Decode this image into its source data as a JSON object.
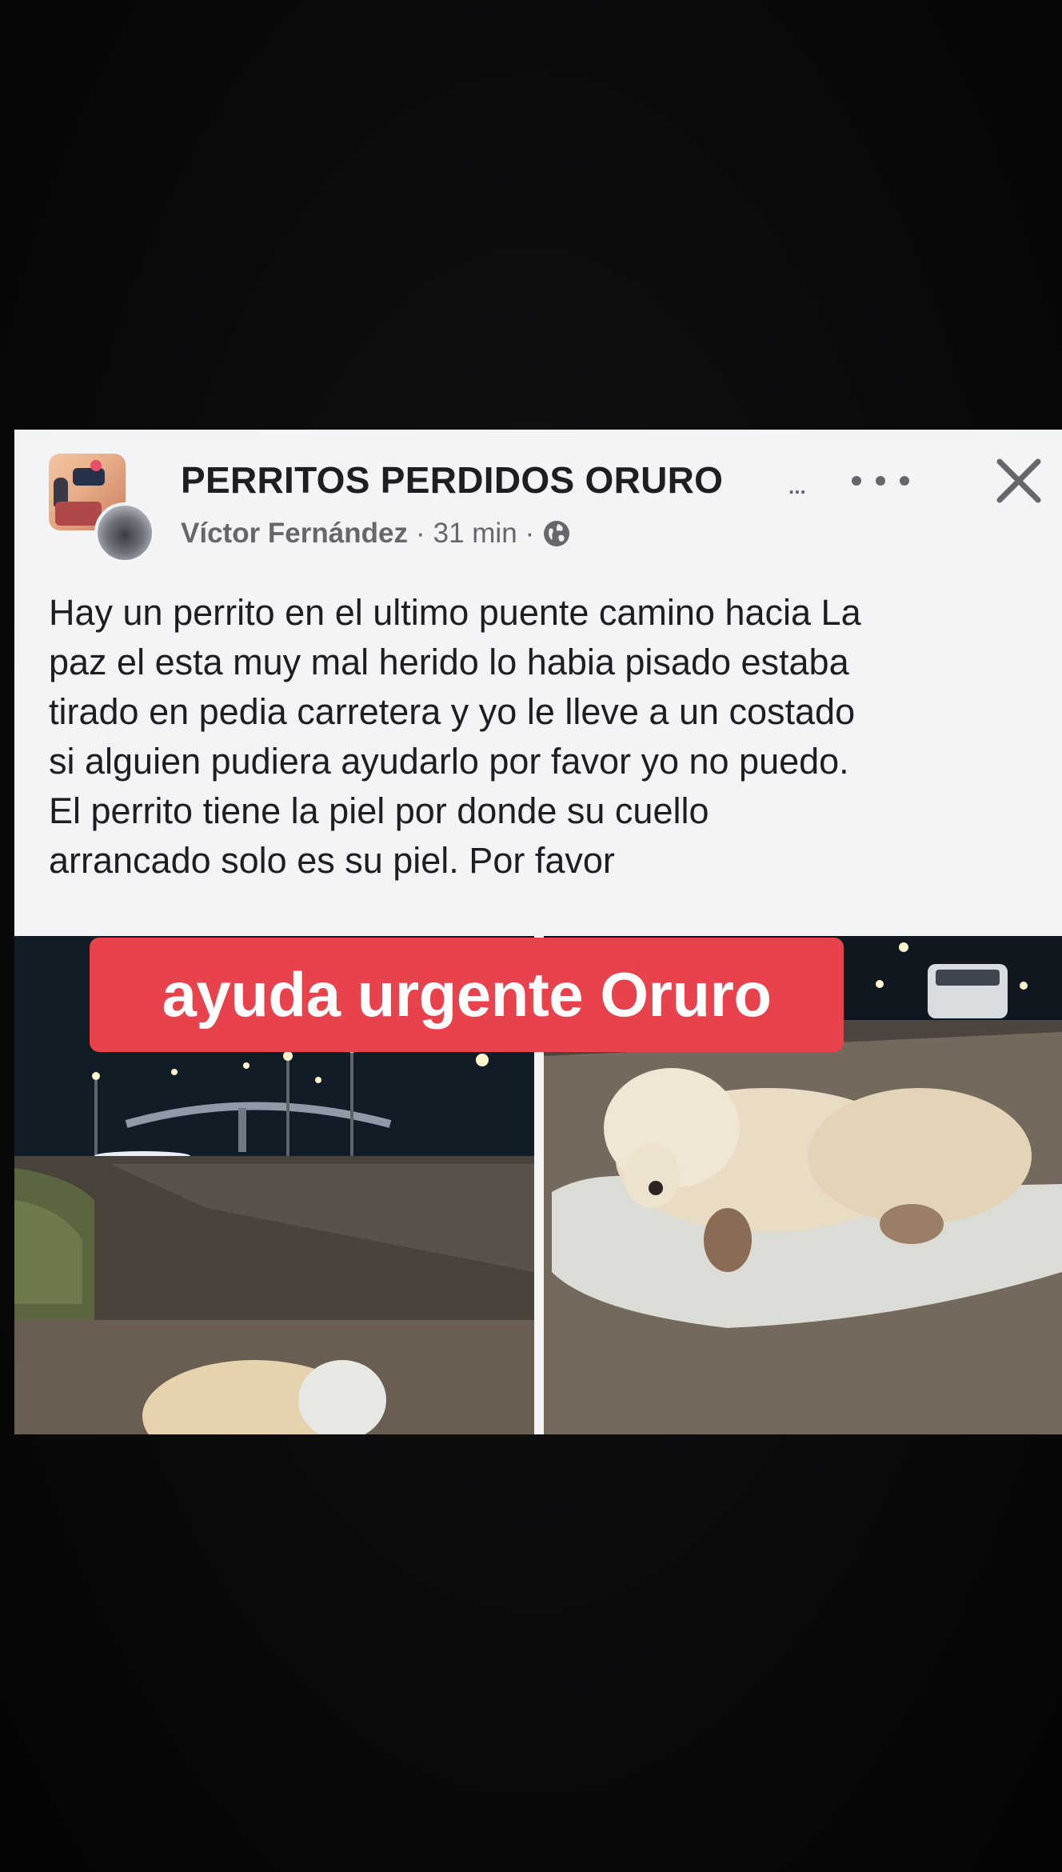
{
  "post": {
    "group_name": "PERRITOS PERDIDOS ORURO",
    "group_name_overflow": "...",
    "author": "Víctor Fernández",
    "separator": "·",
    "time": "31 min",
    "audience_icon": "globe-icon",
    "more_icon": "more-options-icon",
    "close_icon": "close-icon",
    "body_lines": [
      "Hay un perrito en el ultimo puente camino hacia La",
      "paz el esta muy mal herido lo habia pisado estaba",
      "tirado en pedia carretera y yo le lleve a un costado",
      "si alguien pudiera ayudarlo por favor yo no puedo.",
      "El perrito tiene la piel por donde su cuello",
      "arrancado solo es su piel. Por favor"
    ]
  },
  "banner": {
    "text": "ayuda urgente Oruro",
    "background": "#e8424c"
  },
  "colors": {
    "page_background": "#070708",
    "card_background": "#f3f4f6",
    "primary_text": "#1c1e21",
    "secondary_text": "#65676b"
  }
}
